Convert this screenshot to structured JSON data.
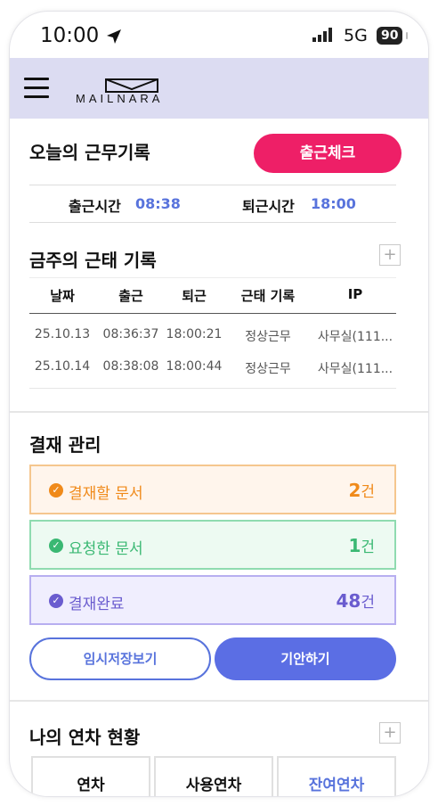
{
  "status": {
    "time": "10:00",
    "network": "5G",
    "battery": "90"
  },
  "header": {
    "logo_text": "MAILNARA"
  },
  "today": {
    "title": "오늘의 근무기록",
    "checkin_label": "출근체크",
    "in_label": "출근시간",
    "in_time": "08:38",
    "out_label": "퇴근시간",
    "out_time": "18:00"
  },
  "week": {
    "title": "금주의 근태 기록",
    "plus": "+",
    "columns": [
      "날짜",
      "출근",
      "퇴근",
      "근태 기록",
      "IP"
    ],
    "rows": [
      [
        "25.10.13",
        "08:36:37",
        "18:00:21",
        "정상근무",
        "사무실(111..."
      ],
      [
        "25.10.14",
        "08:38:08",
        "18:00:44",
        "정상근무",
        "사무실(111..."
      ]
    ]
  },
  "approval": {
    "title": "결재 관리",
    "cards": [
      {
        "label": "결재할 문서",
        "count": "2",
        "unit": "건",
        "color": "#f08a1a",
        "bg": "#fff5ec",
        "border": "#f5c68e"
      },
      {
        "label": "요청한 문서",
        "count": "1",
        "unit": "건",
        "color": "#3ab873",
        "bg": "#edfaf2",
        "border": "#8fdbb0"
      },
      {
        "label": "결재완료",
        "count": "48",
        "unit": "건",
        "color": "#6a5ccf",
        "bg": "#f0eefe",
        "border": "#b7aef0"
      }
    ],
    "draft_button": "임시저장보기",
    "compose_button": "기안하기"
  },
  "leave": {
    "title": "나의 연차 현황",
    "plus": "+",
    "tabs": [
      "연차",
      "사용연차",
      "잔여연차"
    ]
  }
}
